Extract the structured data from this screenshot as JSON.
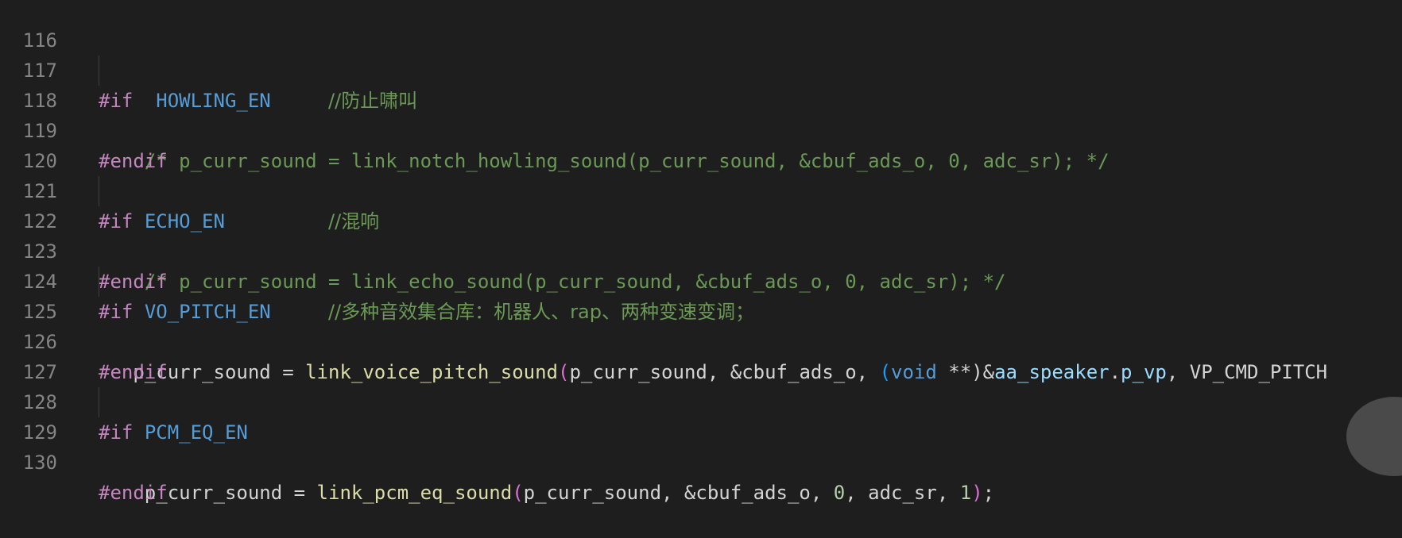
{
  "editor": {
    "lines": [
      {
        "number": "116"
      },
      {
        "number": "117",
        "directive": "#if",
        "macro": "HOWLING_EN",
        "comment": "//防止啸叫"
      },
      {
        "number": "118",
        "comment": "/* p_curr_sound = link_notch_howling_sound(p_curr_sound, &cbuf_ads_o, 0, adc_sr); */"
      },
      {
        "number": "119",
        "directive": "#endif"
      },
      {
        "number": "120"
      },
      {
        "number": "121",
        "directive": "#if",
        "macro": "ECHO_EN",
        "comment": "//混响"
      },
      {
        "number": "122",
        "comment": "/* p_curr_sound = link_echo_sound(p_curr_sound, &cbuf_ads_o, 0, adc_sr); */"
      },
      {
        "number": "123",
        "directive": "#endif"
      },
      {
        "number": "124",
        "directive": "#if",
        "macro": "VO_PITCH_EN",
        "comment": "//多种音效集合库：机器人、rap、两种变速变调；"
      },
      {
        "number": "125",
        "var": "p_curr_sound",
        "assign": " = ",
        "func": "link_voice_pitch_sound",
        "open": "(",
        "args1": "p_curr_sound, &cbuf_ads_o, ",
        "cast_open": "(",
        "kw": "void",
        "cast_rest": " **)",
        "amp": "&",
        "obj": "aa_speaker",
        "dot": ".",
        "member": "p_vp",
        "args2": ", VP_CMD_PITCH"
      },
      {
        "number": "126",
        "directive": "#endif"
      },
      {
        "number": "127"
      },
      {
        "number": "128",
        "directive": "#if",
        "macro": "PCM_EQ_EN"
      },
      {
        "number": "129",
        "var": "p_curr_sound",
        "assign": " = ",
        "func": "link_pcm_eq_sound",
        "open": "(",
        "args1": "p_curr_sound, &cbuf_ads_o, ",
        "num1": "0",
        "args2": ", adc_sr, ",
        "num2": "1",
        "close": ")",
        "end": ";"
      },
      {
        "number": "130",
        "directive": "#endif"
      }
    ]
  }
}
